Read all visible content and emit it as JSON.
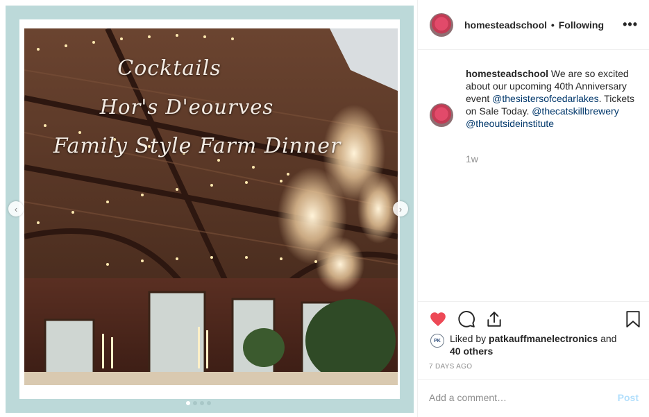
{
  "media": {
    "overlay_lines": [
      "Cocktails",
      "Hor's D'eourves",
      "Family Style Farm Dinner"
    ],
    "dots_count": 4,
    "active_dot": 0,
    "prev_icon": "chevron-left-icon",
    "next_icon": "chevron-right-icon",
    "frame_color": "#bcd9d9"
  },
  "header": {
    "username": "homesteadschool",
    "separator": "•",
    "follow_status": "Following",
    "more_label": "•••"
  },
  "caption": {
    "username": "homesteadschool",
    "text_1": " We are so excited about our upcoming 40th Anniversary event ",
    "mention_1": "@thesistersofcedarlakes",
    "text_2": ". Tickets on Sale Today. ",
    "mention_2": "@thecatskillbrewery",
    "mention_3": "@theoutsideinstitute",
    "time": "1w"
  },
  "actions": {
    "heart_icon": "heart-icon",
    "comment_icon": "comment-icon",
    "share_icon": "share-icon",
    "bookmark_icon": "bookmark-icon",
    "liked_prefix": "Liked by ",
    "liked_user": "patkauffmanelectronics",
    "liked_and": " and",
    "liked_others": "40 others",
    "pk_badge": "PK",
    "ago": "7 DAYS AGO",
    "like_color": "#ed4956"
  },
  "comment": {
    "placeholder": "Add a comment…",
    "post_label": "Post"
  }
}
